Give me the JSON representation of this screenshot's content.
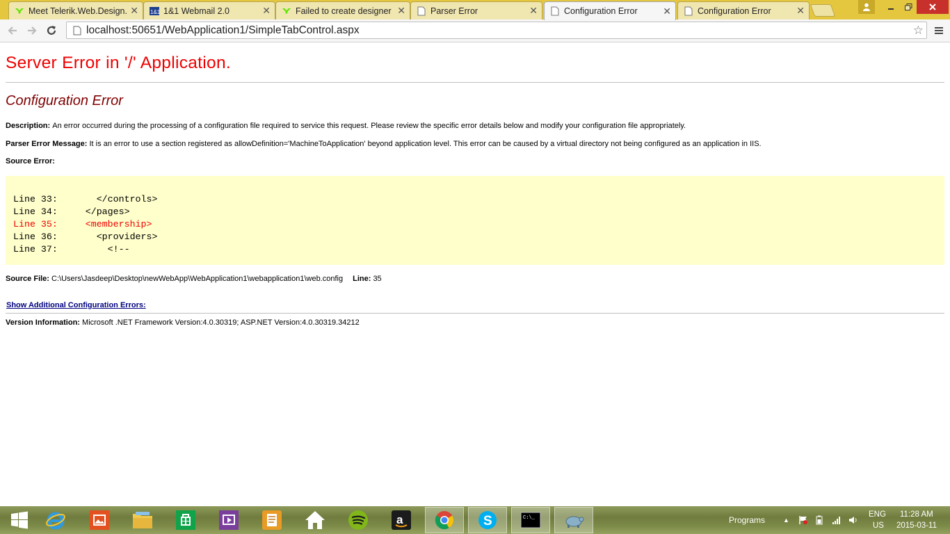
{
  "tabs": [
    {
      "title": "Meet Telerik.Web.Design.",
      "favicon": "telerik-icon",
      "active": false
    },
    {
      "title": "1&1 Webmail 2.0",
      "favicon": "webmail-icon",
      "active": false
    },
    {
      "title": "Failed to create designer",
      "favicon": "telerik-icon",
      "active": false
    },
    {
      "title": "Parser Error",
      "favicon": "page-icon",
      "active": false
    },
    {
      "title": "Configuration Error",
      "favicon": "page-icon",
      "active": true
    },
    {
      "title": "Configuration Error",
      "favicon": "page-icon",
      "active": false
    }
  ],
  "omnibox": {
    "url": "localhost:50651/WebApplication1/SimpleTabControl.aspx"
  },
  "page": {
    "heading": "Server Error in '/' Application.",
    "subheading": "Configuration Error",
    "description_label": "Description:",
    "description_text": "An error occurred during the processing of a configuration file required to service this request. Please review the specific error details below and modify your configuration file appropriately.",
    "parser_label": "Parser Error Message:",
    "parser_text": "It is an error to use a section registered as allowDefinition='MachineToApplication' beyond application level.  This error can be caused by a virtual directory not being configured as an application in IIS.",
    "source_error_label": "Source Error:",
    "source_lines": [
      {
        "text": "Line 33:       </controls>",
        "error": false
      },
      {
        "text": "Line 34:     </pages>",
        "error": false
      },
      {
        "text": "Line 35:     <membership>",
        "error": true
      },
      {
        "text": "Line 36:       <providers>",
        "error": false
      },
      {
        "text": "Line 37:         <!--",
        "error": false
      }
    ],
    "source_file_label": "Source File:",
    "source_file_path": "C:\\Users\\Jasdeep\\Desktop\\newWebApp\\WebApplication1\\webapplication1\\web.config",
    "line_label": "Line:",
    "line_number": "35",
    "show_more_link": "Show Additional Configuration Errors:",
    "version_label": "Version Information:",
    "version_text": "Microsoft .NET Framework Version:4.0.30319; ASP.NET Version:4.0.30319.34212"
  },
  "taskbar": {
    "pinned_icons": [
      "windows-start-icon",
      "internet-explorer-icon",
      "photos-icon",
      "file-explorer-icon",
      "store-icon",
      "media-icon",
      "notes-icon",
      "home-icon",
      "spotify-icon",
      "amazon-icon",
      "chrome-icon",
      "skype-icon",
      "command-prompt-icon",
      "tortoise-icon"
    ],
    "tray": {
      "programs_label": "Programs",
      "lang_line1": "ENG",
      "lang_line2": "US",
      "time": "11:28 AM",
      "date": "2015-03-11"
    }
  },
  "colors": {
    "heading_red": "#e00000",
    "subheading_maroon": "#800000",
    "code_bg": "#ffffcc",
    "link_navy": "#000080",
    "tabstrip": "#e4c73f"
  }
}
